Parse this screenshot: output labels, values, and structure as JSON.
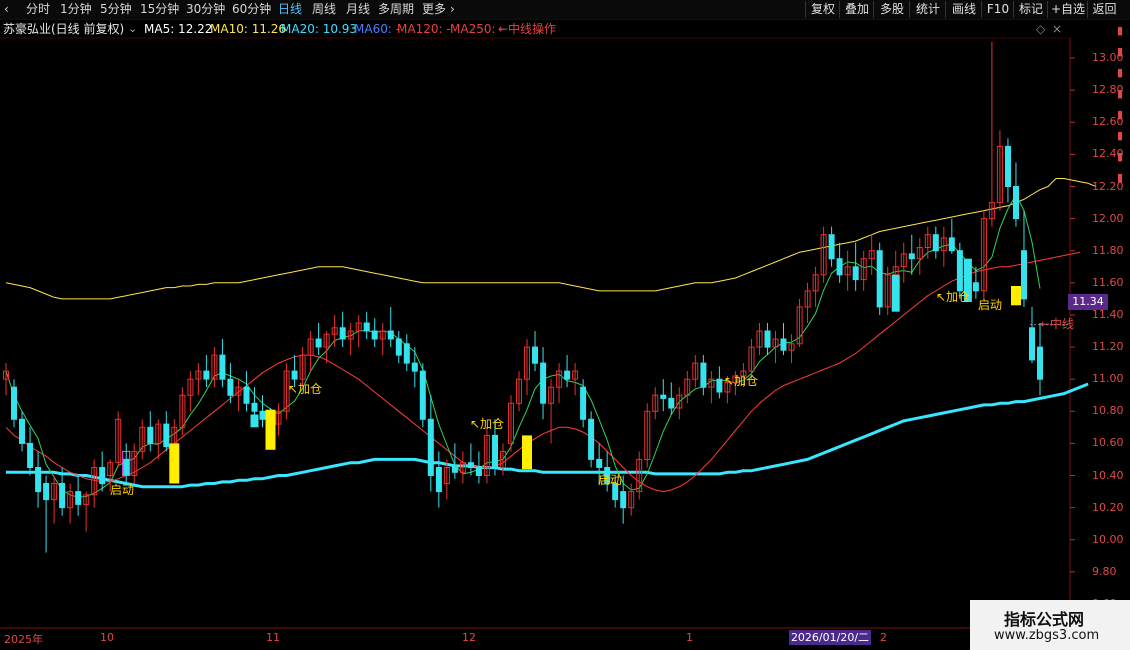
{
  "toolbar": {
    "tabs": [
      "分时",
      "1分钟",
      "5分钟",
      "15分钟",
      "30分钟",
      "60分钟",
      "日线",
      "周线",
      "月线",
      "多周期",
      "更多"
    ],
    "active": "日线",
    "right_buttons": [
      "复权",
      "叠加",
      "多股",
      "统计",
      "画线",
      "F10",
      "标记",
      "+自选",
      "返回"
    ]
  },
  "info": {
    "stock": "苏豪弘业(日线 前复权)",
    "ma5": "MA5: 12.22",
    "ma10": "MA10: 11.26",
    "ma20": "MA20: 10.93",
    "ma60": "MA60: -",
    "ma120": "MA120: -",
    "ma250": "MA250: -",
    "strategy": "←中线操作"
  },
  "colors": {
    "up": "#e8302f",
    "down": "#34e3ee",
    "ma5": "#ffffff",
    "ma10": "#ffe64d",
    "ma20": "#ff3a3a",
    "mid": "#39e6ff",
    "signal": "#ffee00"
  },
  "current_price": "11.34",
  "date_label": "2026/01/20/二",
  "x_labels": [
    "2025年",
    "10",
    "11",
    "12",
    "1",
    "2"
  ],
  "annotations": {
    "qidong1": "启动",
    "jiacang1": "↖加仓",
    "jiacang2": "↖加仓",
    "qidong2": "启动",
    "jiacang3": "↖加仓",
    "jiacang4": "↖加仓",
    "qidong3": "启动",
    "zhong": "←中线"
  },
  "watermark": {
    "line1": "指标公式网",
    "line2": "www.zbgs3.com"
  },
  "chart_data": {
    "type": "candlestick",
    "ylim": [
      9.5,
      13.1
    ],
    "yticks": [
      9.6,
      9.8,
      10.0,
      10.2,
      10.4,
      10.6,
      10.8,
      11.0,
      11.2,
      11.4,
      11.6,
      11.8,
      12.0,
      12.2,
      12.4,
      12.6,
      12.8,
      13.0
    ],
    "candles": [
      [
        11.0,
        11.1,
        10.9,
        11.05
      ],
      [
        10.95,
        11.0,
        10.7,
        10.75
      ],
      [
        10.75,
        10.8,
        10.55,
        10.6
      ],
      [
        10.6,
        10.7,
        10.4,
        10.45
      ],
      [
        10.45,
        10.55,
        10.2,
        10.3
      ],
      [
        10.35,
        10.4,
        9.92,
        10.25
      ],
      [
        10.25,
        10.4,
        10.1,
        10.35
      ],
      [
        10.35,
        10.45,
        10.15,
        10.2
      ],
      [
        10.2,
        10.35,
        10.1,
        10.3
      ],
      [
        10.3,
        10.4,
        10.15,
        10.22
      ],
      [
        10.22,
        10.3,
        10.05,
        10.28
      ],
      [
        10.28,
        10.5,
        10.2,
        10.45
      ],
      [
        10.45,
        10.55,
        10.3,
        10.35
      ],
      [
        10.4,
        10.5,
        10.3,
        10.48
      ],
      [
        10.48,
        10.8,
        10.45,
        10.75
      ],
      [
        10.5,
        10.6,
        10.35,
        10.4
      ],
      [
        10.4,
        10.6,
        10.35,
        10.55
      ],
      [
        10.55,
        10.75,
        10.5,
        10.7
      ],
      [
        10.7,
        10.8,
        10.55,
        10.6
      ],
      [
        10.6,
        10.75,
        10.5,
        10.72
      ],
      [
        10.72,
        10.8,
        10.55,
        10.58
      ],
      [
        10.58,
        10.75,
        10.5,
        10.7
      ],
      [
        10.7,
        10.95,
        10.65,
        10.9
      ],
      [
        10.9,
        11.05,
        10.8,
        11.0
      ],
      [
        11.0,
        11.1,
        10.9,
        11.05
      ],
      [
        11.05,
        11.15,
        10.95,
        11.0
      ],
      [
        11.0,
        11.2,
        10.95,
        11.15
      ],
      [
        11.15,
        11.25,
        10.95,
        11.0
      ],
      [
        11.0,
        11.1,
        10.85,
        10.9
      ],
      [
        10.9,
        11.0,
        10.8,
        10.95
      ],
      [
        10.95,
        11.05,
        10.8,
        10.85
      ],
      [
        10.85,
        10.95,
        10.75,
        10.8
      ],
      [
        10.8,
        10.9,
        10.7,
        10.75
      ],
      [
        10.75,
        10.82,
        10.68,
        10.72
      ],
      [
        10.72,
        10.85,
        10.65,
        10.8
      ],
      [
        10.8,
        11.1,
        10.75,
        11.05
      ],
      [
        11.05,
        11.15,
        10.95,
        11.0
      ],
      [
        11.0,
        11.2,
        10.95,
        11.15
      ],
      [
        11.15,
        11.3,
        11.05,
        11.25
      ],
      [
        11.25,
        11.35,
        11.15,
        11.2
      ],
      [
        11.2,
        11.3,
        11.1,
        11.28
      ],
      [
        11.28,
        11.4,
        11.2,
        11.32
      ],
      [
        11.32,
        11.42,
        11.2,
        11.25
      ],
      [
        11.25,
        11.35,
        11.15,
        11.3
      ],
      [
        11.3,
        11.4,
        11.2,
        11.35
      ],
      [
        11.35,
        11.42,
        11.25,
        11.3
      ],
      [
        11.3,
        11.38,
        11.2,
        11.25
      ],
      [
        11.25,
        11.35,
        11.15,
        11.3
      ],
      [
        11.3,
        11.45,
        11.2,
        11.25
      ],
      [
        11.25,
        11.3,
        11.1,
        11.15
      ],
      [
        11.22,
        11.28,
        11.05,
        11.1
      ],
      [
        11.1,
        11.2,
        10.95,
        11.05
      ],
      [
        11.05,
        11.1,
        10.7,
        10.75
      ],
      [
        10.75,
        10.9,
        10.3,
        10.4
      ],
      [
        10.45,
        10.55,
        10.2,
        10.3
      ],
      [
        10.35,
        10.5,
        10.25,
        10.45
      ],
      [
        10.45,
        10.6,
        10.38,
        10.42
      ],
      [
        10.42,
        10.55,
        10.35,
        10.48
      ],
      [
        10.48,
        10.6,
        10.4,
        10.45
      ],
      [
        10.45,
        10.55,
        10.35,
        10.4
      ],
      [
        10.4,
        10.7,
        10.35,
        10.65
      ],
      [
        10.65,
        10.75,
        10.4,
        10.45
      ],
      [
        10.45,
        10.6,
        10.4,
        10.55
      ],
      [
        10.6,
        10.9,
        10.55,
        10.85
      ],
      [
        10.85,
        11.05,
        10.8,
        11.0
      ],
      [
        11.0,
        11.25,
        10.9,
        11.2
      ],
      [
        11.2,
        11.3,
        11.05,
        11.1
      ],
      [
        11.1,
        11.2,
        10.75,
        10.85
      ],
      [
        10.85,
        11.0,
        10.6,
        10.95
      ],
      [
        10.95,
        11.1,
        10.85,
        11.05
      ],
      [
        11.05,
        11.15,
        10.95,
        11.0
      ],
      [
        11.0,
        11.1,
        10.9,
        11.05
      ],
      [
        10.95,
        11.0,
        10.7,
        10.75
      ],
      [
        10.75,
        10.8,
        10.45,
        10.5
      ],
      [
        10.5,
        10.6,
        10.35,
        10.45
      ],
      [
        10.45,
        10.55,
        10.3,
        10.35
      ],
      [
        10.35,
        10.4,
        10.2,
        10.25
      ],
      [
        10.3,
        10.4,
        10.1,
        10.2
      ],
      [
        10.2,
        10.35,
        10.15,
        10.3
      ],
      [
        10.3,
        10.55,
        10.25,
        10.5
      ],
      [
        10.5,
        10.85,
        10.45,
        10.8
      ],
      [
        10.8,
        10.95,
        10.75,
        10.9
      ],
      [
        10.9,
        11.0,
        10.8,
        10.88
      ],
      [
        10.88,
        10.98,
        10.78,
        10.82
      ],
      [
        10.82,
        10.95,
        10.75,
        10.9
      ],
      [
        10.9,
        11.05,
        10.85,
        11.0
      ],
      [
        11.0,
        11.15,
        10.95,
        11.1
      ],
      [
        11.1,
        11.15,
        10.9,
        10.95
      ],
      [
        10.95,
        11.05,
        10.85,
        11.0
      ],
      [
        11.0,
        11.08,
        10.88,
        10.92
      ],
      [
        10.92,
        11.02,
        10.85,
        10.98
      ],
      [
        10.98,
        11.05,
        10.9,
        11.02
      ],
      [
        11.02,
        11.1,
        10.95,
        11.05
      ],
      [
        11.05,
        11.25,
        11.0,
        11.2
      ],
      [
        11.2,
        11.35,
        11.15,
        11.3
      ],
      [
        11.3,
        11.35,
        11.15,
        11.2
      ],
      [
        11.2,
        11.3,
        11.1,
        11.25
      ],
      [
        11.25,
        11.35,
        11.15,
        11.18
      ],
      [
        11.18,
        11.28,
        11.1,
        11.22
      ],
      [
        11.22,
        11.5,
        11.2,
        11.45
      ],
      [
        11.45,
        11.6,
        11.35,
        11.55
      ],
      [
        11.55,
        11.7,
        11.45,
        11.65
      ],
      [
        11.65,
        11.95,
        11.6,
        11.9
      ],
      [
        11.9,
        11.95,
        11.7,
        11.75
      ],
      [
        11.75,
        11.85,
        11.6,
        11.65
      ],
      [
        11.65,
        11.8,
        11.55,
        11.7
      ],
      [
        11.7,
        11.85,
        11.55,
        11.62
      ],
      [
        11.62,
        11.8,
        11.55,
        11.75
      ],
      [
        11.75,
        11.9,
        11.65,
        11.8
      ],
      [
        11.8,
        11.85,
        11.4,
        11.45
      ],
      [
        11.45,
        11.7,
        11.4,
        11.65
      ],
      [
        11.65,
        11.8,
        11.55,
        11.7
      ],
      [
        11.7,
        11.85,
        11.6,
        11.78
      ],
      [
        11.78,
        11.9,
        11.65,
        11.75
      ],
      [
        11.75,
        11.88,
        11.65,
        11.82
      ],
      [
        11.82,
        11.95,
        11.75,
        11.9
      ],
      [
        11.9,
        11.95,
        11.75,
        11.8
      ],
      [
        11.8,
        11.95,
        11.7,
        11.88
      ],
      [
        11.88,
        12.0,
        11.78,
        11.8
      ],
      [
        11.8,
        11.85,
        11.5,
        11.55
      ],
      [
        11.55,
        11.75,
        11.5,
        11.6
      ],
      [
        11.6,
        11.7,
        11.5,
        11.55
      ],
      [
        11.55,
        12.05,
        11.5,
        12.0
      ],
      [
        12.0,
        13.1,
        11.95,
        12.1
      ],
      [
        12.1,
        12.55,
        12.05,
        12.45
      ],
      [
        12.45,
        12.5,
        12.1,
        12.2
      ],
      [
        12.2,
        12.35,
        11.95,
        12.0
      ],
      [
        11.8,
        12.05,
        11.45,
        11.5
      ],
      [
        11.32,
        11.45,
        11.1,
        11.12
      ],
      [
        11.2,
        11.35,
        10.9,
        11.0
      ]
    ],
    "ma20": [
      10.7,
      10.65,
      10.62,
      10.58,
      10.55,
      10.52,
      10.48,
      10.45,
      10.42,
      10.4,
      10.38,
      10.37,
      10.36,
      10.36,
      10.38,
      10.4,
      10.42,
      10.45,
      10.48,
      10.52,
      10.56,
      10.6,
      10.64,
      10.68,
      10.72,
      10.76,
      10.8,
      10.84,
      10.88,
      10.92,
      10.96,
      11.0,
      11.04,
      11.07,
      11.1,
      11.12,
      11.14,
      11.15,
      11.15,
      11.14,
      11.12,
      11.09,
      11.06,
      11.03,
      11.0,
      10.96,
      10.92,
      10.88,
      10.84,
      10.8,
      10.76,
      10.72,
      10.68,
      10.64,
      10.6,
      10.56,
      10.52,
      10.48,
      10.46,
      10.45,
      10.45,
      10.46,
      10.48,
      10.52,
      10.56,
      10.6,
      10.63,
      10.66,
      10.68,
      10.7,
      10.7,
      10.69,
      10.67,
      10.64,
      10.6,
      10.55,
      10.5,
      10.45,
      10.4,
      10.36,
      10.33,
      10.31,
      10.3,
      10.31,
      10.33,
      10.36,
      10.4,
      10.45,
      10.5,
      10.56,
      10.62,
      10.68,
      10.74,
      10.8,
      10.85,
      10.89,
      10.93,
      10.96,
      10.98,
      11.0,
      11.02,
      11.04,
      11.06,
      11.08,
      11.1,
      11.13,
      11.16,
      11.2,
      11.24,
      11.28,
      11.32,
      11.36,
      11.4,
      11.44,
      11.48,
      11.52,
      11.55,
      11.58,
      11.61,
      11.63,
      11.65,
      11.67,
      11.68,
      11.69,
      11.7,
      11.7,
      11.71,
      11.72,
      11.73,
      11.74,
      11.75,
      11.76,
      11.77,
      11.78,
      11.79
    ],
    "yellow_band": [
      11.6,
      11.59,
      11.58,
      11.57,
      11.55,
      11.53,
      11.51,
      11.5,
      11.5,
      11.5,
      11.5,
      11.5,
      11.5,
      11.5,
      11.51,
      11.52,
      11.53,
      11.54,
      11.55,
      11.56,
      11.57,
      11.57,
      11.58,
      11.58,
      11.59,
      11.59,
      11.6,
      11.6,
      11.6,
      11.6,
      11.61,
      11.62,
      11.63,
      11.64,
      11.65,
      11.66,
      11.67,
      11.68,
      11.69,
      11.7,
      11.7,
      11.7,
      11.7,
      11.69,
      11.68,
      11.67,
      11.66,
      11.65,
      11.64,
      11.63,
      11.62,
      11.61,
      11.6,
      11.6,
      11.6,
      11.6,
      11.6,
      11.6,
      11.6,
      11.6,
      11.6,
      11.6,
      11.6,
      11.6,
      11.6,
      11.6,
      11.6,
      11.6,
      11.6,
      11.6,
      11.59,
      11.58,
      11.57,
      11.56,
      11.55,
      11.55,
      11.55,
      11.55,
      11.55,
      11.55,
      11.55,
      11.55,
      11.56,
      11.57,
      11.58,
      11.59,
      11.6,
      11.6,
      11.6,
      11.61,
      11.62,
      11.63,
      11.65,
      11.67,
      11.69,
      11.71,
      11.73,
      11.75,
      11.77,
      11.79,
      11.8,
      11.81,
      11.82,
      11.83,
      11.84,
      11.85,
      11.86,
      11.88,
      11.9,
      11.92,
      11.93,
      11.94,
      11.95,
      11.96,
      11.97,
      11.98,
      11.99,
      12.0,
      12.01,
      12.02,
      12.03,
      12.04,
      12.05,
      12.06,
      12.07,
      12.08,
      12.1,
      12.12,
      12.15,
      12.18,
      12.2,
      12.25,
      12.25,
      12.24,
      12.23,
      12.22,
      12.2
    ],
    "mid_line": [
      10.42,
      10.42,
      10.42,
      10.42,
      10.42,
      10.42,
      10.42,
      10.41,
      10.41,
      10.4,
      10.4,
      10.39,
      10.38,
      10.37,
      10.36,
      10.35,
      10.34,
      10.33,
      10.33,
      10.33,
      10.33,
      10.33,
      10.33,
      10.34,
      10.34,
      10.35,
      10.35,
      10.36,
      10.36,
      10.37,
      10.37,
      10.38,
      10.38,
      10.39,
      10.4,
      10.4,
      10.41,
      10.42,
      10.43,
      10.44,
      10.45,
      10.46,
      10.47,
      10.48,
      10.48,
      10.49,
      10.5,
      10.5,
      10.5,
      10.5,
      10.5,
      10.5,
      10.49,
      10.48,
      10.48,
      10.47,
      10.46,
      10.46,
      10.46,
      10.45,
      10.45,
      10.45,
      10.44,
      10.44,
      10.43,
      10.43,
      10.43,
      10.42,
      10.42,
      10.42,
      10.42,
      10.42,
      10.42,
      10.42,
      10.42,
      10.42,
      10.42,
      10.42,
      10.42,
      10.42,
      10.42,
      10.41,
      10.41,
      10.41,
      10.41,
      10.41,
      10.41,
      10.41,
      10.41,
      10.41,
      10.42,
      10.42,
      10.43,
      10.43,
      10.44,
      10.45,
      10.46,
      10.47,
      10.48,
      10.49,
      10.5,
      10.52,
      10.54,
      10.56,
      10.58,
      10.6,
      10.62,
      10.64,
      10.66,
      10.68,
      10.7,
      10.72,
      10.74,
      10.75,
      10.76,
      10.77,
      10.78,
      10.79,
      10.8,
      10.81,
      10.82,
      10.83,
      10.84,
      10.84,
      10.85,
      10.85,
      10.86,
      10.86,
      10.87,
      10.88,
      10.89,
      10.9,
      10.91,
      10.93,
      10.95,
      10.97
    ]
  }
}
